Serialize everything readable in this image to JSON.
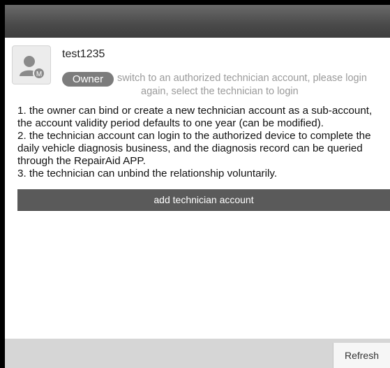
{
  "user": {
    "username": "test1235",
    "role": "Owner",
    "switch_note_line1": "switch to an authorized technician account, please login",
    "switch_note_line2": "again, select the technician to login",
    "avatar_badge": "M"
  },
  "instructions": [
    "1. the owner can bind or create a new technician account as a sub-account,",
    "the account validity period defaults to one year (can be modified).",
    "2. the technician account can login to the authorized device to complete the",
    "daily vehicle diagnosis business, and the diagnosis record can be queried",
    "through the RepairAid APP.",
    "3. the technician can unbind the relationship voluntarily."
  ],
  "actions": {
    "add_technician_label": "add technician account",
    "refresh_label": "Refresh"
  },
  "icons": {
    "avatar": "user-avatar-icon"
  },
  "colors": {
    "topbar": "#4a4a4a",
    "badge": "#7c7c7c",
    "button": "#5a5a5a",
    "footer": "#d6d6d6"
  }
}
